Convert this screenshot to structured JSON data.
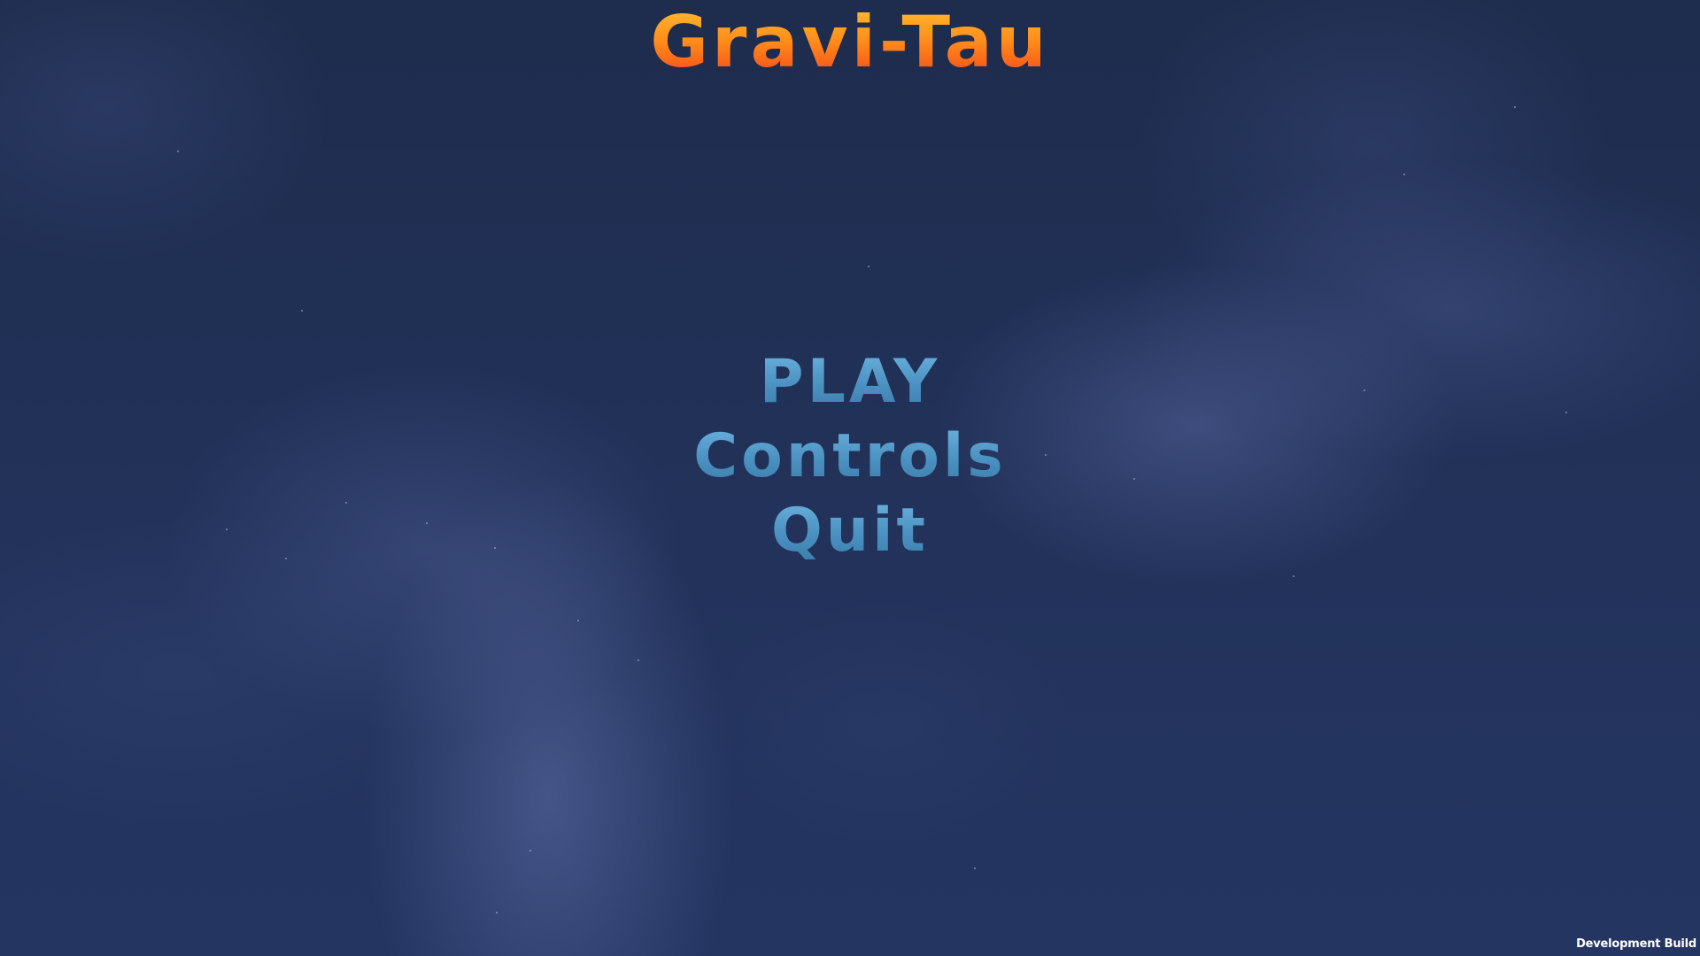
{
  "game": {
    "title": "Gravi-Tau",
    "title_colors": [
      "#ffc233",
      "#ff8a1a",
      "#f2401a"
    ]
  },
  "menu": {
    "items": [
      {
        "label": "PLAY"
      },
      {
        "label": "Controls"
      },
      {
        "label": "Quit"
      }
    ],
    "text_color": "#5aa3d2"
  },
  "footer": {
    "build_label": "Development Build"
  },
  "background": {
    "sky_color": "#1f2d50"
  }
}
